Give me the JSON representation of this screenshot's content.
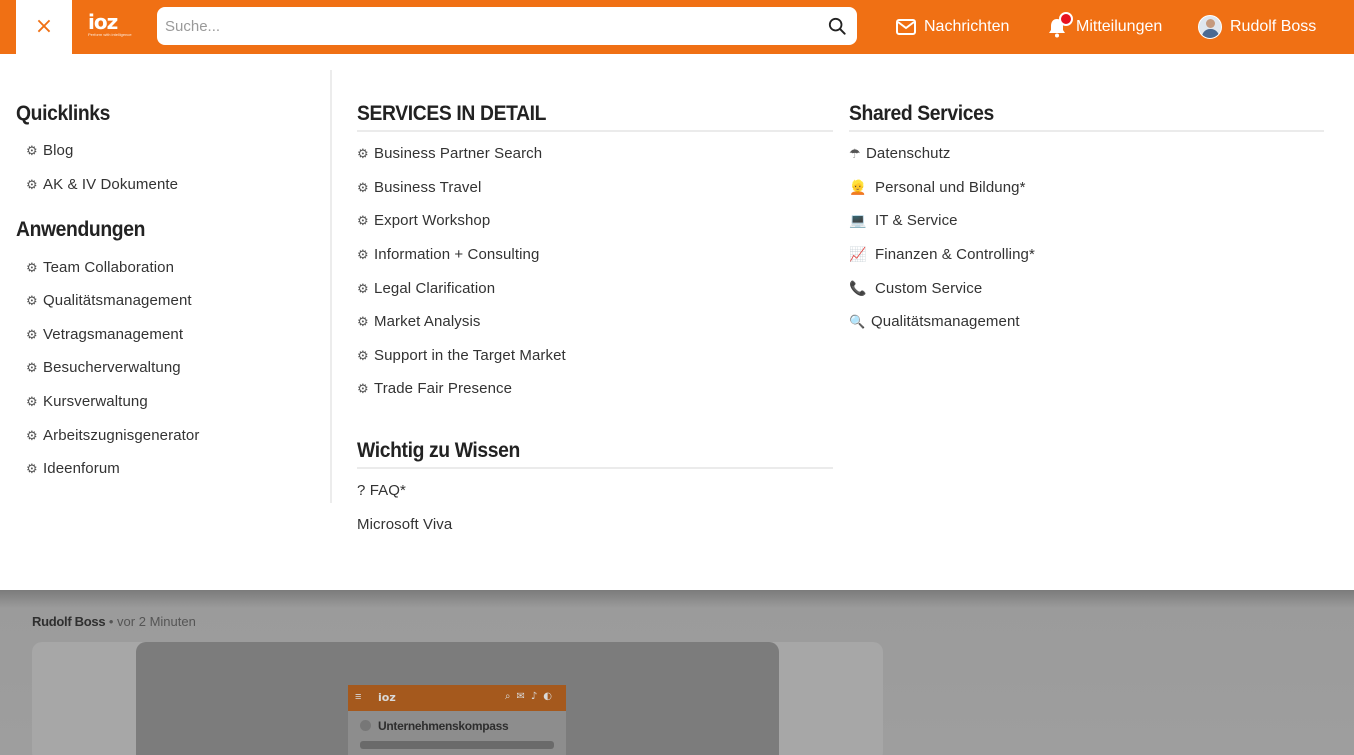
{
  "header": {
    "close_symbol": "×",
    "logo_text": "ioz",
    "logo_tagline": "Perform with intelligence",
    "search_placeholder": "Suche...",
    "messages_label": "Nachrichten",
    "notifications_label": "Mitteilungen",
    "user_name": "Rudolf Boss",
    "brand_color": "#f07014",
    "notification_dot_color": "#e8121f"
  },
  "quicklinks": {
    "title": "Quicklinks",
    "items": [
      {
        "icon": "⚙",
        "label": "Blog"
      },
      {
        "icon": "⚙",
        "label": "AK & IV Dokumente"
      }
    ]
  },
  "anwendungen": {
    "title": "Anwendungen",
    "items": [
      {
        "icon": "⚙",
        "label": "Team Collaboration"
      },
      {
        "icon": "⚙",
        "label": "Qualitätsmanagement"
      },
      {
        "icon": "⚙",
        "label": "Vetragsmanagement"
      },
      {
        "icon": "⚙",
        "label": "Besucherverwaltung"
      },
      {
        "icon": "⚙",
        "label": "Kursverwaltung"
      },
      {
        "icon": "⚙",
        "label": "Arbeitszugnisgenerator"
      },
      {
        "icon": "⚙",
        "label": "Ideenforum"
      }
    ]
  },
  "services_detail": {
    "title": "SERVICES IN DETAIL",
    "items": [
      {
        "icon": "⚙",
        "label": "Business Partner Search"
      },
      {
        "icon": "⚙",
        "label": "Business Travel"
      },
      {
        "icon": "⚙",
        "label": "Export Workshop"
      },
      {
        "icon": "⚙",
        "label": "Information + Consulting"
      },
      {
        "icon": "⚙",
        "label": "Legal Clarification"
      },
      {
        "icon": "⚙",
        "label": "Market Analysis"
      },
      {
        "icon": "⚙",
        "label": "Support in the Target Market"
      },
      {
        "icon": "⚙",
        "label": "Trade Fair Presence"
      }
    ]
  },
  "wichtig": {
    "title": "Wichtig zu Wissen",
    "items": [
      {
        "label": "? FAQ*"
      },
      {
        "label": "Microsoft Viva"
      }
    ]
  },
  "shared_services": {
    "title": "Shared Services",
    "items": [
      {
        "icon": "☂",
        "icon_name": "umbrella-icon",
        "label": "Datenschutz"
      },
      {
        "icon": "👱",
        "icon_name": "person-icon",
        "label": "Personal und Bildung*"
      },
      {
        "icon": "💻",
        "icon_name": "laptop-icon",
        "label": "IT & Service"
      },
      {
        "icon": "📈",
        "icon_name": "chart-increasing-icon",
        "label": "Finanzen & Controlling*"
      },
      {
        "icon": "📞",
        "icon_name": "telephone-icon",
        "label": "Custom Service"
      },
      {
        "icon": "🔍",
        "icon_name": "magnifier-icon",
        "label": "Qualitätsmanagement"
      }
    ]
  },
  "feed": {
    "author": "Rudolf Boss",
    "time": "• vor 2 Minuten",
    "preview_logo": "ioz",
    "preview_title": "Unternehmenskompass"
  }
}
